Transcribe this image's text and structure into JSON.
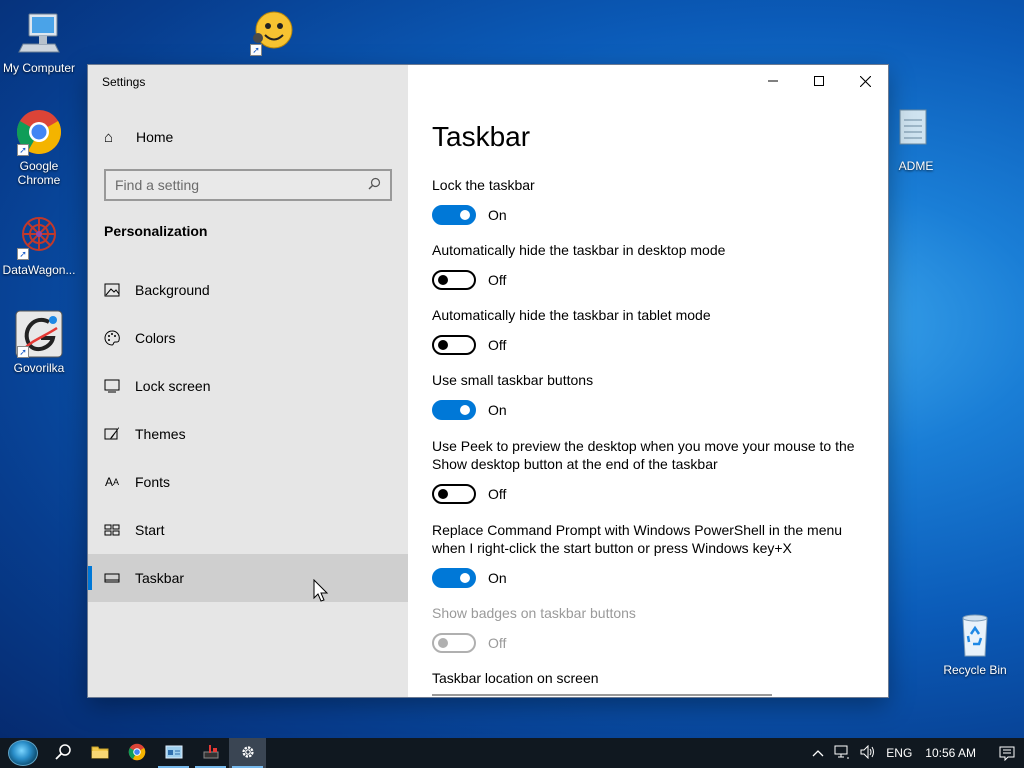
{
  "desktop": {
    "icons": [
      {
        "label": "My Computer",
        "icon": "computer-icon"
      },
      {
        "label": "Google Chrome",
        "icon": "chrome-icon"
      },
      {
        "label": "DataWagon...",
        "icon": "datawagon-icon"
      },
      {
        "label": "Govorilka",
        "icon": "govorilka-icon"
      },
      {
        "label": "ADME",
        "icon": "notepad-icon"
      },
      {
        "label": "Recycle Bin",
        "icon": "recycle-bin-icon"
      }
    ]
  },
  "window": {
    "title": "Settings",
    "controls": {
      "minimize": "—",
      "maximize": "☐",
      "close": "✕"
    }
  },
  "sidebar": {
    "home_label": "Home",
    "search_placeholder": "Find a setting",
    "section_title": "Personalization",
    "items": [
      {
        "label": "Background",
        "icon": "picture-icon"
      },
      {
        "label": "Colors",
        "icon": "palette-icon"
      },
      {
        "label": "Lock screen",
        "icon": "lock-screen-icon"
      },
      {
        "label": "Themes",
        "icon": "themes-icon"
      },
      {
        "label": "Fonts",
        "icon": "fonts-icon"
      },
      {
        "label": "Start",
        "icon": "start-icon"
      },
      {
        "label": "Taskbar",
        "icon": "taskbar-icon",
        "active": true
      }
    ]
  },
  "content": {
    "title": "Taskbar",
    "settings": [
      {
        "label": "Lock the taskbar",
        "state": "On",
        "on": true
      },
      {
        "label": "Automatically hide the taskbar in desktop mode",
        "state": "Off",
        "on": false
      },
      {
        "label": "Automatically hide the taskbar in tablet mode",
        "state": "Off",
        "on": false
      },
      {
        "label": "Use small taskbar buttons",
        "state": "On",
        "on": true
      },
      {
        "label": "Use Peek to preview the desktop when you move your mouse to the Show desktop button at the end of the taskbar",
        "state": "Off",
        "on": false
      },
      {
        "label": "Replace Command Prompt with Windows PowerShell in the menu when I right-click the start button or press Windows key+X",
        "state": "On",
        "on": true
      },
      {
        "label": "Show badges on taskbar buttons",
        "state": "Off",
        "on": false,
        "disabled": true
      }
    ],
    "location_label": "Taskbar location on screen"
  },
  "taskbar": {
    "language": "ENG",
    "time": "10:56 AM"
  },
  "colors": {
    "accent": "#0078d7",
    "sidebar_bg": "#e6e6e6",
    "taskbar_bg": "#101820"
  }
}
